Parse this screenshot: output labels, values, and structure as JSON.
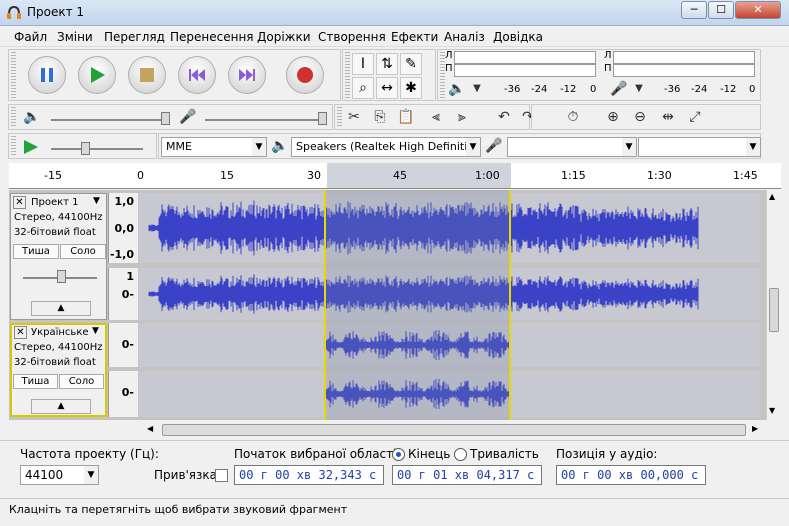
{
  "window": {
    "title": "Проект 1",
    "minimize": "─",
    "maximize": "☐",
    "close": "✕"
  },
  "menu": [
    "Файл",
    "Зміни",
    "Перегляд",
    "Перенесення",
    "Доріжки",
    "Створення",
    "Ефекти",
    "Аналіз",
    "Довідка"
  ],
  "meters": {
    "left": "Л",
    "right": "П",
    "scale_a": [
      "-36",
      "-24",
      "-12",
      "0"
    ],
    "scale_b": [
      "-36",
      "-24",
      "-12",
      "0"
    ]
  },
  "device": {
    "host": "MME",
    "output": "Speakers (Realtek High Definiti",
    "input": "",
    "channels": ""
  },
  "ruler": [
    "-15",
    "0",
    "15",
    "30",
    "45",
    "1:00",
    "1:15",
    "1:30",
    "1:45"
  ],
  "tracks": [
    {
      "name": "Проект 1",
      "format": "Стерео, 44100Hz",
      "bits": "32-бітовий float",
      "mute": "Тиша",
      "solo": "Соло",
      "scale_top": [
        "1,0",
        "0,0",
        "-1,0"
      ],
      "scale_bottom": [
        "1",
        "0-"
      ]
    },
    {
      "name": "Українське",
      "format": "Стерео, 44100Hz",
      "bits": "32-бітовий float",
      "mute": "Тиша",
      "solo": "Соло",
      "scale_top": [
        "0-"
      ],
      "scale_bottom": [
        "0-"
      ]
    }
  ],
  "selection": {
    "rate_label": "Частота проекту (Гц):",
    "rate_value": "44100",
    "snap_label": "Прив'язка",
    "start_label": "Початок вибраної області:",
    "end_label": "Кінець",
    "length_label": "Тривалість",
    "pos_label": "Позиція у аудіо:",
    "start_value": "00 г 00 хв 32,343 с",
    "end_value": "00 г 01 хв 04,317 с",
    "pos_value": "00 г 00 хв 00,000 с"
  },
  "status": "Клацніть та перетягніть щоб вибрати звуковий фрагмент",
  "colors": {
    "wave": "#3a43c7",
    "selection": "#e8d800",
    "time_text": "#1f3fa8"
  }
}
